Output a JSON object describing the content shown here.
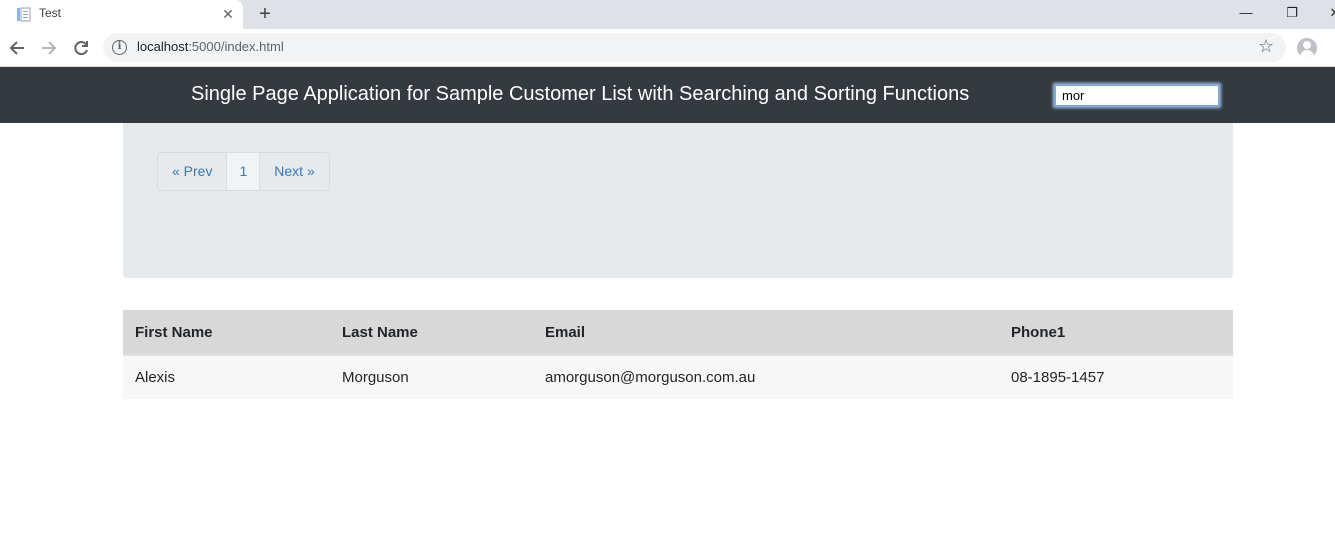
{
  "browser": {
    "tab_title": "Test",
    "url_host": "localhost",
    "url_path": ":5000/index.html"
  },
  "app": {
    "title": "Single Page Application for Sample Customer List with Searching and Sorting Functions",
    "search": {
      "value": "mor"
    }
  },
  "pagination": {
    "prev_label": "« Prev",
    "current_page": "1",
    "next_label": "Next »"
  },
  "table": {
    "headers": [
      "First Name",
      "Last Name",
      "Email",
      "Phone1"
    ],
    "rows": [
      [
        "Alexis",
        "Morguson",
        "amorguson@morguson.com.au",
        "08-1895-1457"
      ]
    ]
  }
}
